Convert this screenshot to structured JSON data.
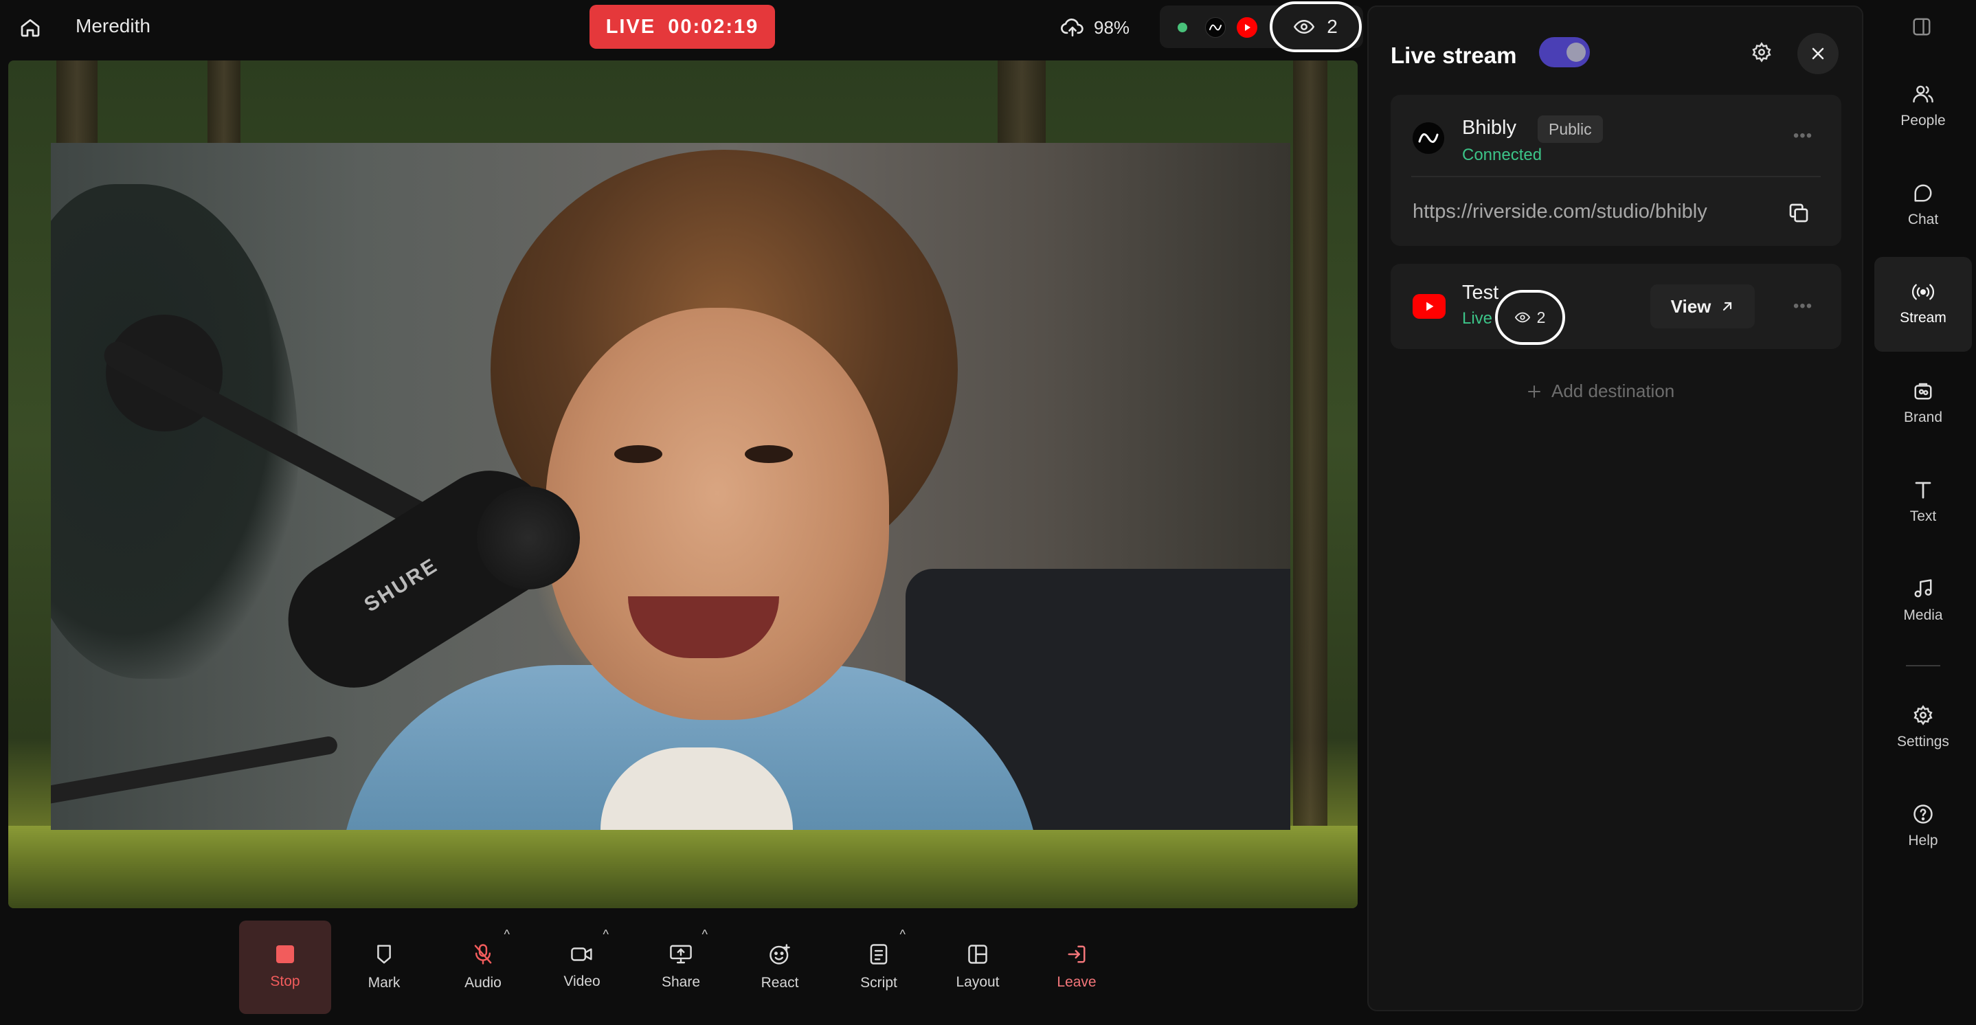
{
  "topbar": {
    "studio_name": "Meredith",
    "live_label": "LIVE",
    "live_timer": "00:02:19",
    "upload_percent": "98%",
    "viewer_count": "2"
  },
  "stage": {
    "mic_brand": "SHURE"
  },
  "toolbar": {
    "items": [
      {
        "label": "Stop"
      },
      {
        "label": "Mark"
      },
      {
        "label": "Audio"
      },
      {
        "label": "Video"
      },
      {
        "label": "Share"
      },
      {
        "label": "React"
      },
      {
        "label": "Script"
      },
      {
        "label": "Layout"
      },
      {
        "label": "Leave"
      }
    ]
  },
  "panel": {
    "title": "Live stream",
    "toggle_on": true,
    "destinations": [
      {
        "name": "Bhibly",
        "badge": "Public",
        "status": "Connected",
        "url": "https://riverside.com/studio/bhibly"
      },
      {
        "name": "Test",
        "status": "Live",
        "viewers": "2",
        "view_label": "View"
      }
    ],
    "add_destination": "Add destination"
  },
  "rail": {
    "items": [
      {
        "label": "People"
      },
      {
        "label": "Chat"
      },
      {
        "label": "Stream"
      },
      {
        "label": "Brand"
      },
      {
        "label": "Text"
      },
      {
        "label": "Media"
      },
      {
        "label": "Settings"
      },
      {
        "label": "Help"
      }
    ]
  },
  "colors": {
    "live_red": "#e5383b",
    "connected_green": "#3cc488",
    "toggle_purple": "#4a3fb5",
    "youtube_red": "#ff0000"
  }
}
